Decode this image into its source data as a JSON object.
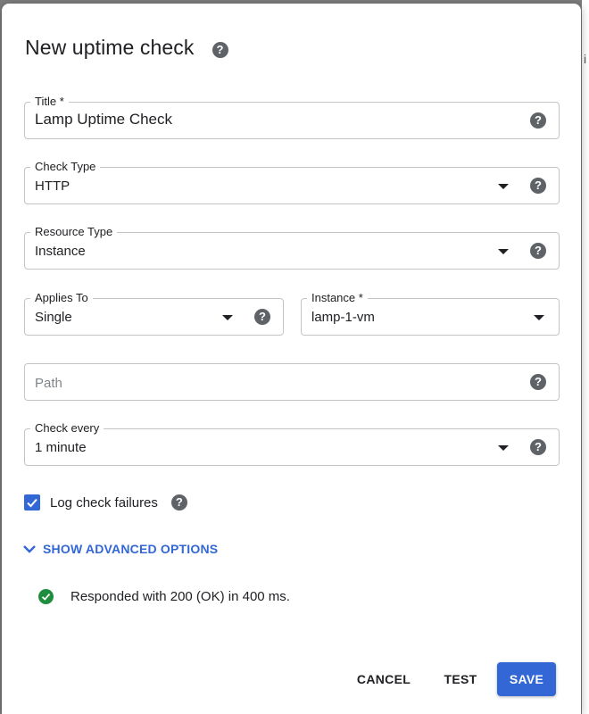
{
  "dialog": {
    "title": "New uptime check",
    "help_glyph": "?"
  },
  "fields": {
    "title": {
      "label": "Title *",
      "value": "Lamp Uptime Check"
    },
    "check_type": {
      "label": "Check Type",
      "value": "HTTP"
    },
    "resource_type": {
      "label": "Resource Type",
      "value": "Instance"
    },
    "applies_to": {
      "label": "Applies To",
      "value": "Single"
    },
    "instance": {
      "label": "Instance *",
      "value": "lamp-1-vm"
    },
    "path": {
      "label": "",
      "value": "",
      "placeholder": "Path"
    },
    "check_every": {
      "label": "Check every",
      "value": "1 minute"
    }
  },
  "log_failures": {
    "label": "Log check failures",
    "checked": true
  },
  "advanced": {
    "label": "SHOW ADVANCED OPTIONS"
  },
  "status": {
    "text": "Responded with 200 (OK) in 400 ms.",
    "state": "success"
  },
  "actions": {
    "cancel": "CANCEL",
    "test": "TEST",
    "save": "SAVE"
  },
  "backdrop": {
    "fragment": "i"
  },
  "icons": {
    "help": "help-circle-icon",
    "dropdown": "arrow-drop-down-icon",
    "check": "checkmark-icon",
    "expand": "chevron-down-icon",
    "success": "check-circle-icon"
  },
  "colors": {
    "accent": "#3367d6",
    "success": "#1e8e3e",
    "help_icon": "#5f6368",
    "border": "#c4c4c4"
  }
}
